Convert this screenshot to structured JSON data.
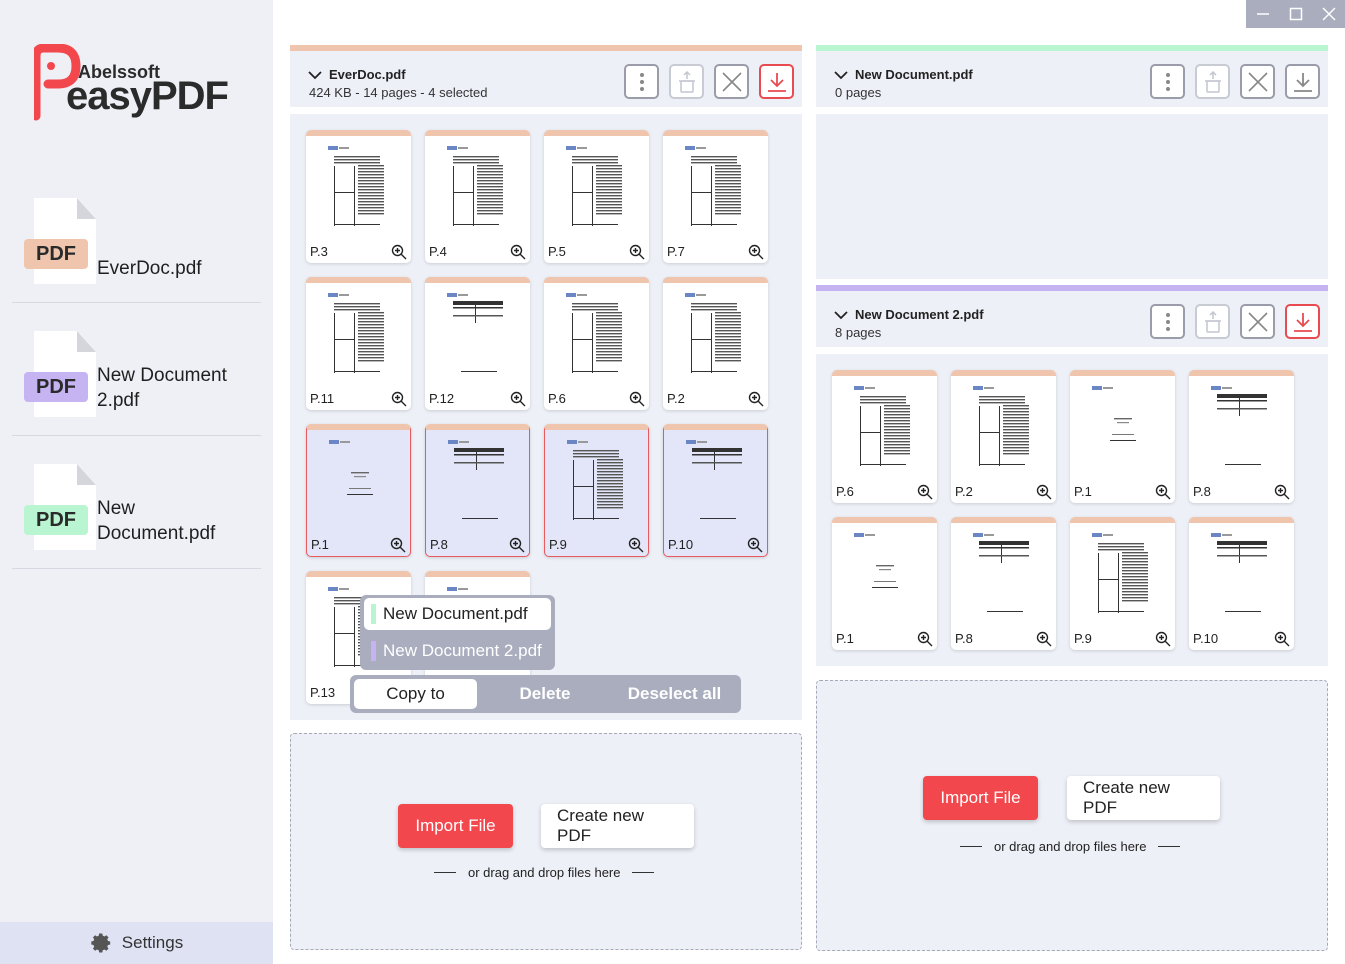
{
  "app": {
    "brand_company": "Abelssoft",
    "brand_product": "easyPDF"
  },
  "sidebar": {
    "docs": [
      {
        "badge": "PDF",
        "name": "EverDoc.pdf",
        "color": "#efc6ad"
      },
      {
        "badge": "PDF",
        "name": "New Document 2.pdf",
        "color": "#c6b3f2"
      },
      {
        "badge": "PDF",
        "name": "New Document.pdf",
        "color": "#b9f5d0"
      }
    ],
    "settings_label": "Settings"
  },
  "panels": {
    "everdoc": {
      "title": "EverDoc.pdf",
      "subtitle": "424 KB - 14 pages - 4 selected",
      "accent": "#efc6ad",
      "pages": [
        "P.3",
        "P.4",
        "P.5",
        "P.7",
        "P.11",
        "P.12",
        "P.6",
        "P.2",
        "P.1",
        "P.8",
        "P.9",
        "P.10",
        "P.13",
        ""
      ]
    },
    "newdoc": {
      "title": "New Document.pdf",
      "subtitle": "0 pages",
      "accent": "#b9f5d0"
    },
    "newdoc2": {
      "title": "New Document 2.pdf",
      "subtitle": "8 pages",
      "accent": "#c6b3f2",
      "pages": [
        "P.6",
        "P.2",
        "P.1",
        "P.8",
        "P.1",
        "P.8",
        "P.9",
        "P.10"
      ]
    }
  },
  "actions": {
    "copy_to": "Copy to",
    "delete": "Delete",
    "deselect_all": "Deselect all",
    "copy_targets": [
      "New Document.pdf",
      "New Document 2.pdf"
    ]
  },
  "dropzone": {
    "import_label": "Import File",
    "create_label": "Create new PDF",
    "hint": "or drag and drop files here"
  },
  "colors": {
    "accent_red": "#f2474d",
    "selection_border": "#e85a5e"
  }
}
